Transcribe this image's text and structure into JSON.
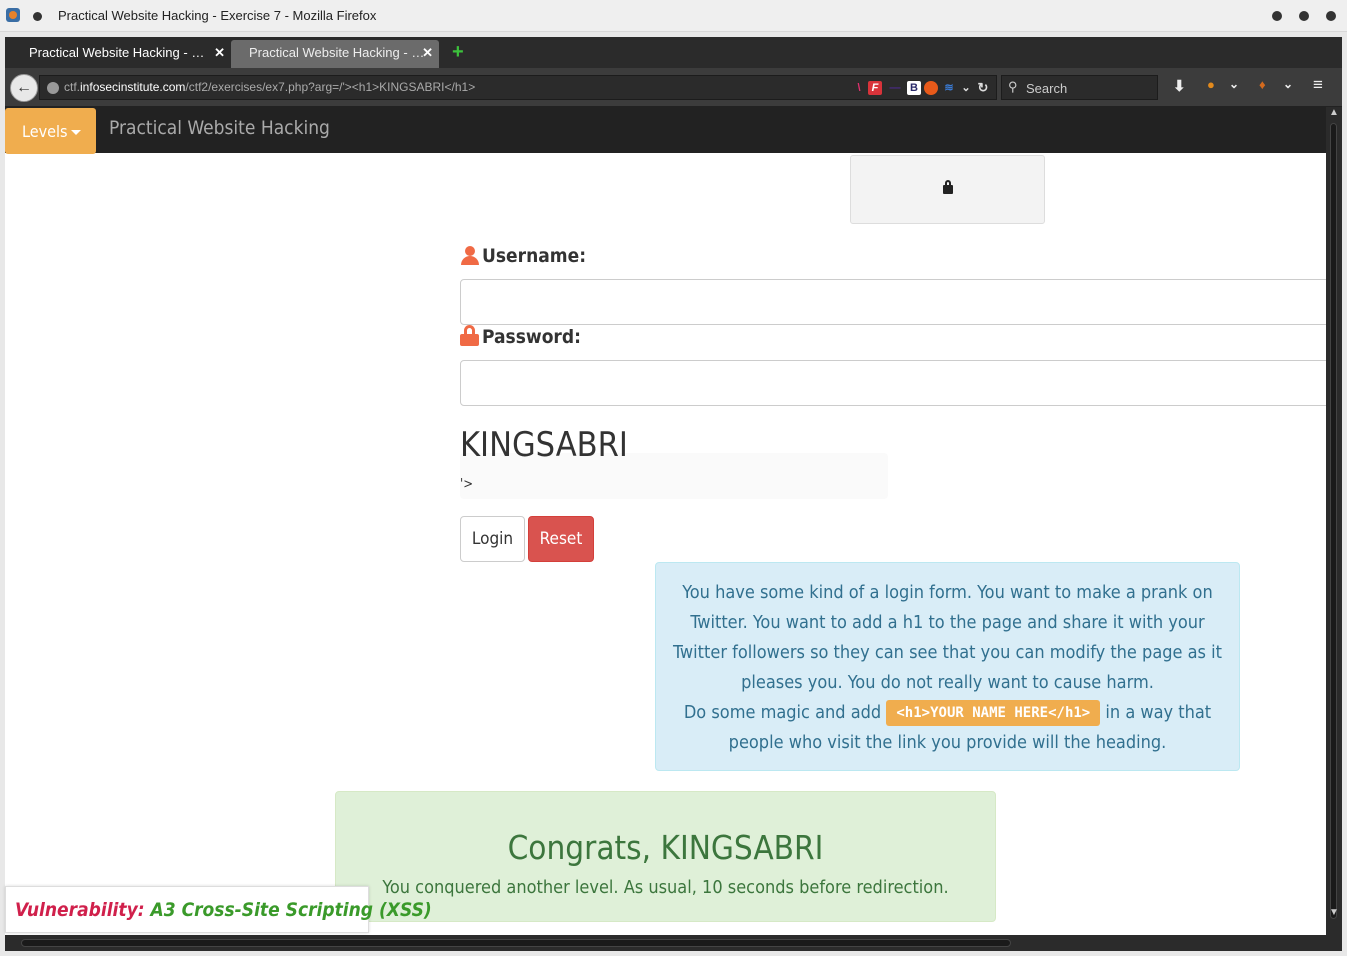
{
  "window": {
    "title": "Practical Website Hacking - Exercise 7 - Mozilla Firefox"
  },
  "tabs": [
    {
      "label": "Practical Website Hacking - …",
      "close": "✕"
    },
    {
      "label": "Practical Website Hacking - …",
      "close": "✕"
    }
  ],
  "new_tab_label": "+",
  "urlbar": {
    "prefix": "ctf.",
    "domain": "infosecinstitute.com",
    "path": "/ctf2/exercises/ex7.php?arg=/'><h1>KINGSABRI</h1>"
  },
  "search": {
    "placeholder": "Search"
  },
  "site": {
    "levels_label": "Levels",
    "brand": "Practical Website Hacking"
  },
  "form": {
    "username_label": "Username:",
    "password_label": "Password:",
    "username_value": "",
    "password_value": "",
    "injected_heading": "KINGSABRI",
    "injected_tail": "'>",
    "login_label": "Login",
    "reset_label": "Reset"
  },
  "info": {
    "paragraph": "You have some kind of a login form. You want to make a prank on Twitter. You want to add a h1 to the page and share it with your Twitter followers so they can see that you can modify the page as it pleases you. You do not really want to cause harm.",
    "line2_before": "Do some magic and add",
    "code": "<h1>YOUR NAME HERE</h1>",
    "line2_after": "in a way that people who visit the link you provide will the heading."
  },
  "success": {
    "title": "Congrats, KINGSABRI",
    "message": "You conquered another level. As usual, 10 seconds before redirection."
  },
  "vulnerability": {
    "key": "Vulnerability:",
    "value": "A3 Cross-Site Scripting (XSS)"
  },
  "colors": {
    "levels_button": "#f0ad4e",
    "reset_button": "#d9534f",
    "info_bg": "#d9edf7",
    "success_bg": "#dff0d8",
    "icon_accent": "#f06a45"
  },
  "icons": [
    "firefox-logo",
    "back-arrow",
    "globe",
    "reload",
    "search",
    "download",
    "menu",
    "user",
    "lock"
  ]
}
